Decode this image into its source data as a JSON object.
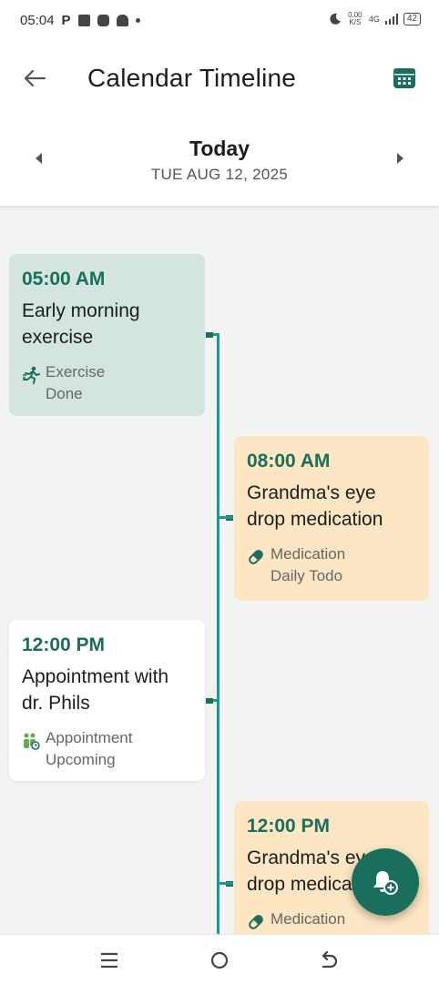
{
  "status_bar": {
    "time": "05:04",
    "carrier_letter": "P",
    "speed": "0.00\nK/S",
    "network": "4G",
    "battery": "42"
  },
  "header": {
    "title": "Calendar Timeline",
    "date_label": "Today",
    "date_sub": "TUE AUG 12, 2025"
  },
  "events": [
    {
      "time": "05:00 AM",
      "title": "Early morning exercise",
      "category": "Exercise",
      "status": "Done",
      "icon": "running-icon",
      "color": "#d4e4df"
    },
    {
      "time": "08:00 AM",
      "title": "Grandma's eye drop medication",
      "category": "Medication",
      "status": "Daily Todo",
      "icon": "pill-icon",
      "color": "#fde6c3"
    },
    {
      "time": "12:00 PM",
      "title": "Appointment with dr. Phils",
      "category": "Appointment",
      "status": "Upcoming",
      "icon": "people-icon",
      "color": "#ffffff"
    },
    {
      "time": "12:00 PM",
      "title": "Grandma's eye drop medication",
      "category": "Medication",
      "status": "",
      "icon": "pill-icon",
      "color": "#fde6c3"
    }
  ],
  "colors": {
    "accent": "#1a6f5c",
    "timeline": "#1a9a8a"
  }
}
